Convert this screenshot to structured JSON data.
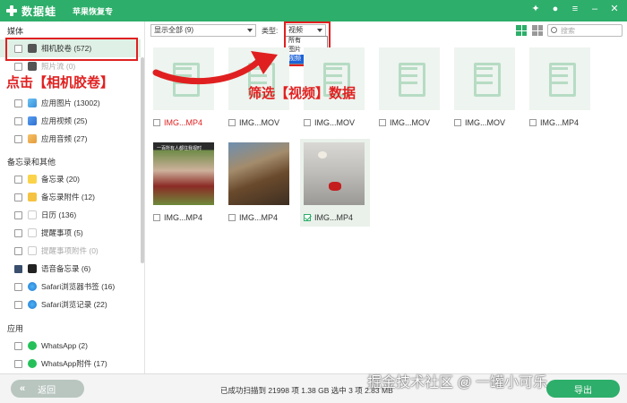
{
  "app": {
    "brand": "数据蛙",
    "title": "苹果恢复专"
  },
  "sidebar": {
    "sections": [
      {
        "title": "媒体"
      },
      {
        "title": "备忘录和其他"
      },
      {
        "title": "应用"
      }
    ],
    "media_items": [
      {
        "label": "相机胶卷 (572)",
        "icon": "camera-icon",
        "checked": false,
        "active": true
      },
      {
        "label": "照片流 (0)",
        "icon": "photo-stream-icon",
        "checked": false,
        "dim": true
      },
      {
        "label": "应用图片 (13002)",
        "icon": "photo-icon",
        "checked": false
      },
      {
        "label": "应用视频 (25)",
        "icon": "video-icon",
        "checked": false
      },
      {
        "label": "应用音频 (27)",
        "icon": "audio-icon",
        "checked": false
      }
    ],
    "notes_items": [
      {
        "label": "备忘录 (20)",
        "icon": "notes-icon",
        "checked": false
      },
      {
        "label": "备忘录附件 (12)",
        "icon": "notes-attachment-icon",
        "checked": false
      },
      {
        "label": "日历 (136)",
        "icon": "calendar-icon",
        "checked": false
      },
      {
        "label": "提醒事项 (5)",
        "icon": "reminders-icon",
        "checked": false
      },
      {
        "label": "提醒事项附件 (0)",
        "icon": "reminders-attachment-icon",
        "checked": false,
        "dim": true
      },
      {
        "label": "语音备忘录 (6)",
        "icon": "voice-memo-icon",
        "checked": true
      },
      {
        "label": "Safari浏览器书签 (16)",
        "icon": "safari-icon",
        "checked": false
      },
      {
        "label": "Safari浏览记录 (22)",
        "icon": "safari-icon",
        "checked": false
      }
    ],
    "app_items": [
      {
        "label": "WhatsApp (2)",
        "icon": "whatsapp-icon",
        "checked": false
      },
      {
        "label": "WhatsApp附件 (17)",
        "icon": "whatsapp-icon",
        "checked": false
      }
    ]
  },
  "filter": {
    "show_select": "显示全部 (9)",
    "type_label": "类型:",
    "type_select": "视频",
    "type_options": [
      "所有",
      "图片",
      "视频"
    ],
    "type_selected_index": 2,
    "search_placeholder": "搜索"
  },
  "files": [
    {
      "name": "IMG...MP4",
      "thumb": "video-placeholder",
      "name_color": "red",
      "checked": false
    },
    {
      "name": "IMG...MOV",
      "thumb": "video-placeholder",
      "checked": false
    },
    {
      "name": "IMG...MOV",
      "thumb": "video-placeholder",
      "checked": false
    },
    {
      "name": "IMG...MOV",
      "thumb": "video-placeholder",
      "checked": false
    },
    {
      "name": "IMG...MOV",
      "thumb": "video-placeholder",
      "checked": false
    },
    {
      "name": "IMG...MP4",
      "thumb": "video-placeholder",
      "checked": false
    },
    {
      "name": "IMG...MP4",
      "thumb": "soccer",
      "caption": "一百所有人都往我视时",
      "checked": false
    },
    {
      "name": "IMG...MP4",
      "thumb": "tree",
      "checked": false
    },
    {
      "name": "IMG...MP4",
      "thumb": "spiderman",
      "checked": true,
      "selected": true
    }
  ],
  "annotations": {
    "left": "点击【相机胶卷】",
    "right": "筛选【视频】数据"
  },
  "bottom": {
    "back": "返回",
    "status": "已成功扫描到 21998 项 1.38 GB  选中 3 项 2.83 MB",
    "export": "导出"
  },
  "watermark": "掘金技术社区 @ 一罐小可乐",
  "colors": {
    "brand_green": "#2dae6a",
    "annotation_red": "#e02020",
    "selection_blue": "#1e63d8"
  }
}
